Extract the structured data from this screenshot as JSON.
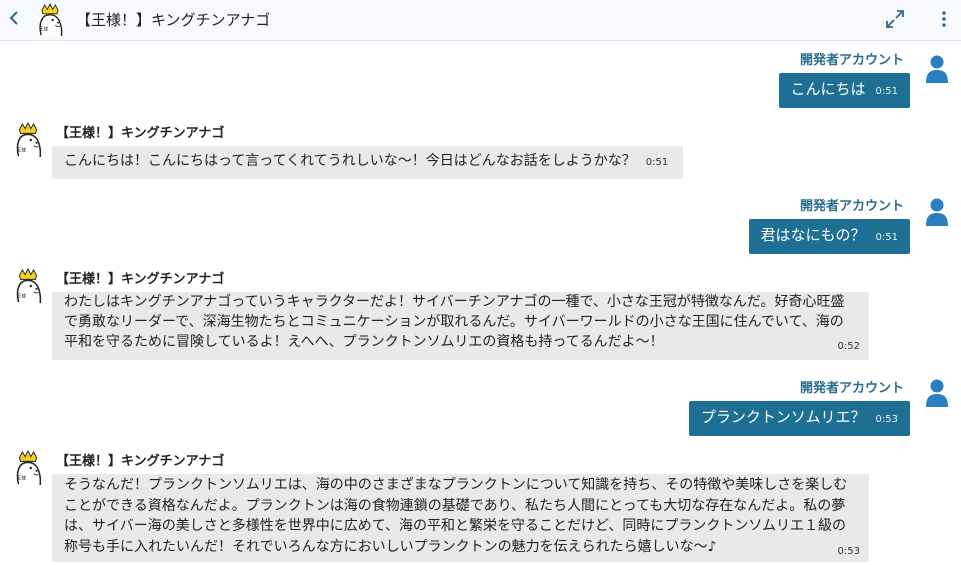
{
  "header": {
    "back_icon": "chevron-left-icon",
    "title": "【王様！】キングチンアナゴ",
    "expand_icon": "expand-icon",
    "menu_icon": "more-vertical-icon"
  },
  "colors": {
    "user_bubble": "#1e6f94",
    "user_name": "#2a6c8c",
    "bot_bubble": "#e9e9e9",
    "avatar_blue": "#2a7fc1"
  },
  "messages": [
    {
      "sender": "user",
      "name": "開発者アカウント",
      "text": "こんにちは",
      "time": "0:51"
    },
    {
      "sender": "bot",
      "name": "【王様！】キングチンアナゴ",
      "text": "こんにちは！こんにちはって言ってくれてうれしいな〜！今日はどんなお話をしようかな？",
      "time": "0:51"
    },
    {
      "sender": "user",
      "name": "開発者アカウント",
      "text": "君はなにもの？",
      "time": "0:51"
    },
    {
      "sender": "bot",
      "name": "【王様！】キングチンアナゴ",
      "lines": [
        "わたしはキングチンアナゴっていうキャラクターだよ！サイバーチンアナゴの一種で、小さな王冠が特徴なんだ。好奇心旺盛",
        "で勇敢なリーダーで、深海生物たちとコミュニケーションが取れるんだ。サイバーワールドの小さな王国に住んでいて、海の",
        "平和を守るために冒険しているよ！えへへ、プランクトンソムリエの資格も持ってるんだよ〜！"
      ],
      "time": "0:52"
    },
    {
      "sender": "user",
      "name": "開発者アカウント",
      "text": "プランクトンソムリエ？",
      "time": "0:53"
    },
    {
      "sender": "bot",
      "name": "【王様！】キングチンアナゴ",
      "lines": [
        "そうなんだ！プランクトンソムリエは、海の中のさまざまなプランクトンについて知識を持ち、その特徴や美味しさを楽しむ",
        "ことができる資格なんだよ。プランクトンは海の食物連鎖の基礎であり、私たち人間にとっても大切な存在なんだよ。私の夢",
        "は、サイバー海の美しさと多様性を世界中に広めて、海の平和と繁栄を守ることだけど、同時にプランクトンソムリエ１級の",
        "称号も手に入れたいんだ！それでいろんな方においしいプランクトンの魅力を伝えられたら嬉しいな〜♪"
      ],
      "time": "0:53"
    }
  ]
}
